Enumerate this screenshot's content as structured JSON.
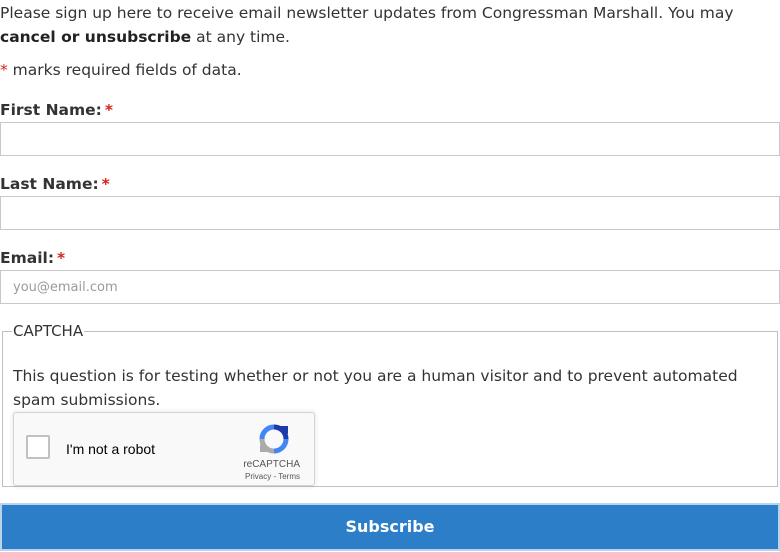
{
  "intro": {
    "text_before": "Please sign up here to receive email newsletter updates from Congressman Marshall. You may ",
    "bold_text": "cancel or unsubscribe",
    "text_after": " at any time."
  },
  "required_note": {
    "star": "*",
    "text": " marks required fields of data."
  },
  "fields": {
    "first_name": {
      "label": "First Name:",
      "value": "",
      "placeholder": ""
    },
    "last_name": {
      "label": "Last Name:",
      "value": "",
      "placeholder": ""
    },
    "email": {
      "label": "Email:",
      "value": "",
      "placeholder": "you@email.com"
    },
    "required_star": "*"
  },
  "captcha": {
    "legend": "CAPTCHA",
    "description": "This question is for testing whether or not you are a human visitor and to prevent automated spam submissions.",
    "checkbox_label": "I'm not a robot",
    "brand": "reCAPTCHA",
    "privacy": "Privacy",
    "separator": " - ",
    "terms": "Terms"
  },
  "submit": {
    "label": "Subscribe"
  },
  "colors": {
    "accent": "#2b7ec7",
    "required": "#d9221c",
    "text": "#333333"
  }
}
